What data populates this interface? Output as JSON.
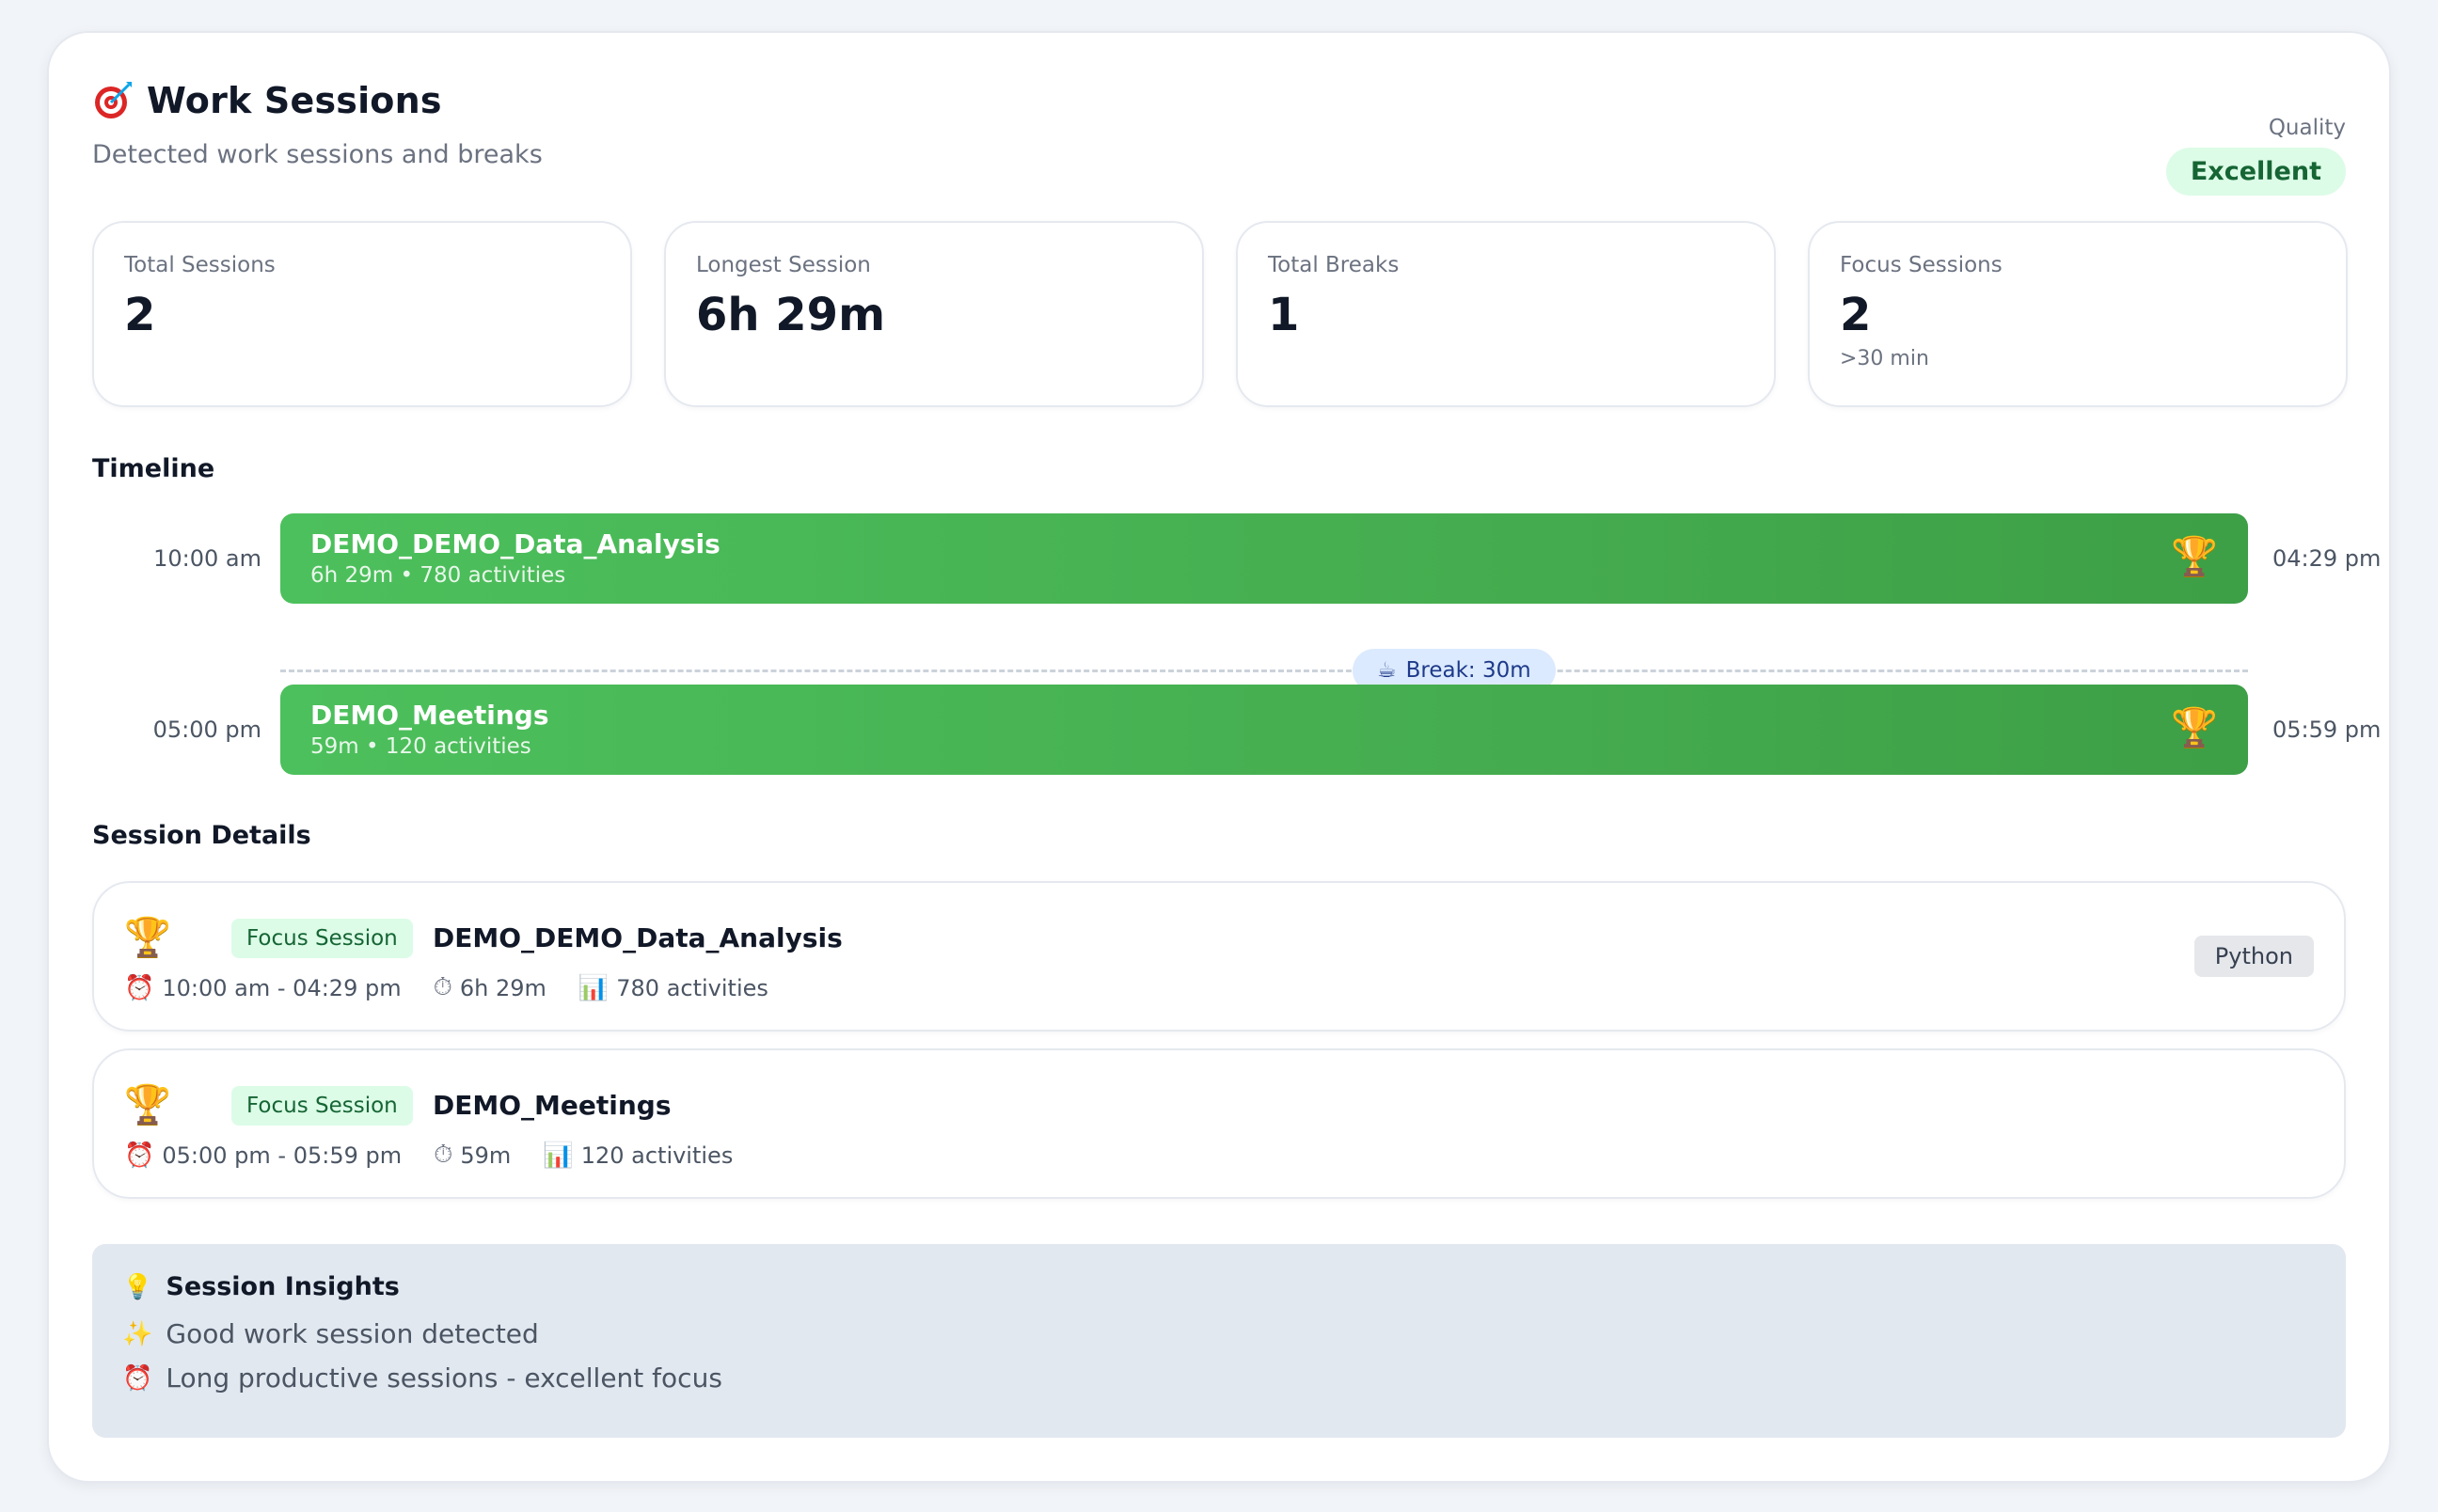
{
  "header": {
    "title": "Work Sessions",
    "subtitle": "Detected work sessions and breaks",
    "quality_label": "Quality",
    "quality_value": "Excellent"
  },
  "stats": [
    {
      "label": "Total Sessions",
      "value": "2",
      "sub": ""
    },
    {
      "label": "Longest Session",
      "value": "6h 29m",
      "sub": ""
    },
    {
      "label": "Total Breaks",
      "value": "1",
      "sub": ""
    },
    {
      "label": "Focus Sessions",
      "value": "2",
      "sub": ">30 min"
    }
  ],
  "timeline": {
    "title": "Timeline",
    "sessions": [
      {
        "start": "10:00 am",
        "end": "04:29 pm",
        "name": "DEMO_DEMO_Data_Analysis",
        "meta": "6h 29m • 780 activities"
      },
      {
        "start": "05:00 pm",
        "end": "05:59 pm",
        "name": "DEMO_Meetings",
        "meta": "59m • 120 activities"
      }
    ],
    "break_label": "Break: 30m"
  },
  "details": {
    "title": "Session Details",
    "items": [
      {
        "badge": "Focus Session",
        "name": "DEMO_DEMO_Data_Analysis",
        "time_range": "10:00 am - 04:29 pm",
        "duration": "6h 29m",
        "activities": "780 activities",
        "tag": "Python"
      },
      {
        "badge": "Focus Session",
        "name": "DEMO_Meetings",
        "time_range": "05:00 pm - 05:59 pm",
        "duration": "59m",
        "activities": "120 activities",
        "tag": ""
      }
    ]
  },
  "insights": {
    "title": "Session Insights",
    "lines": [
      "Good work session detected",
      "Long productive sessions - excellent focus"
    ]
  },
  "icons": {
    "title": "target-icon",
    "trophy": "trophy-icon",
    "break": "coffee-icon",
    "time": "alarm-clock-icon",
    "duration": "stopwatch-icon",
    "activities": "bar-chart-icon",
    "insights": "lightbulb-icon",
    "insight_1": "sparkles-icon",
    "insight_2": "alarm-clock-icon"
  },
  "colors": {
    "session_bar": "#45ad4f",
    "quality_badge_bg": "#dcfce7",
    "quality_badge_text": "#166534",
    "break_pill_bg": "#dbeafe",
    "insights_bg": "#e2e8f0"
  }
}
